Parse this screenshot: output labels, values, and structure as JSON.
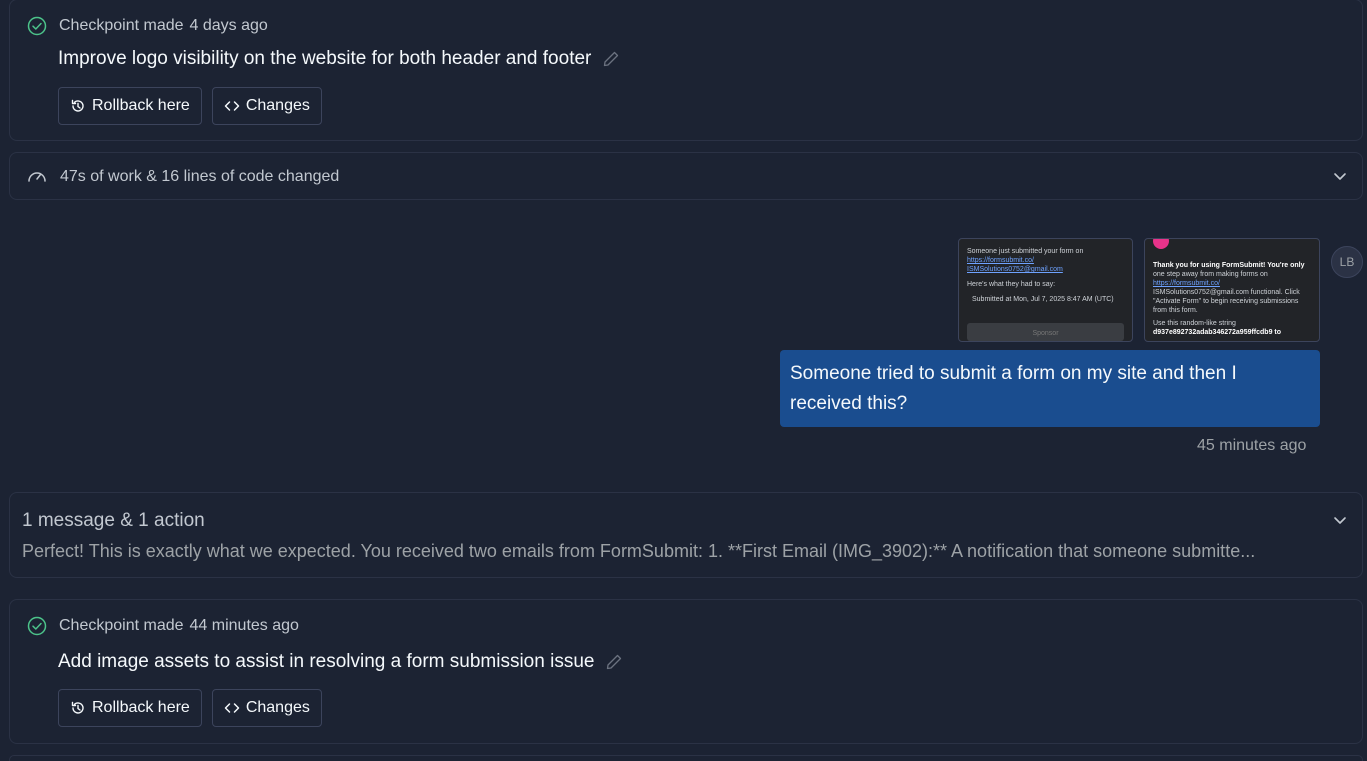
{
  "checkpoints": [
    {
      "label": "Checkpoint made",
      "time": "4 days ago",
      "title": "Improve logo visibility on the website for both header and footer",
      "rollback_label": "Rollback here",
      "changes_label": "Changes"
    },
    {
      "label": "Checkpoint made",
      "time": "44 minutes ago",
      "title": "Add image assets to assist in resolving a form submission issue",
      "rollback_label": "Rollback here",
      "changes_label": "Changes"
    }
  ],
  "work_summary": "47s of work & 16 lines of code changed",
  "user_message": {
    "avatar_initials": "LB",
    "text": "Someone tried to submit a form on my site and then I received this?",
    "time": "45 minutes ago",
    "attachments": [
      {
        "lines": [
          "Someone just submitted your form on",
          "https://formsubmit.co/",
          "ISMSolutions0752@gmail.com",
          "Here's what they had to say:",
          "Submitted at Mon, Jul 7, 2025 8:47 AM (UTC)"
        ],
        "button": "Sponsor"
      },
      {
        "lines": [
          "Thank you for using FormSubmit! You're only",
          "one step away from making forms on",
          "https://formsubmit.co/",
          "ISMSolutions0752@gmail.com functional. Click",
          "\"Activate Form\" to begin receiving submissions",
          "from this form.",
          "Use this random-like string",
          "d937e892732adab346272a959ffcdb9 to"
        ]
      }
    ]
  },
  "actions_summary": {
    "title": "1 message & 1 action",
    "preview": "Perfect! This is exactly what we expected. You received two emails from FormSubmit: 1. **First Email (IMG_3902):** A notification that someone submitte..."
  },
  "colors": {
    "background": "#1c2333",
    "border": "#2b3245",
    "accent_green": "#4cc38a",
    "bubble_blue": "#1a4d8f"
  }
}
